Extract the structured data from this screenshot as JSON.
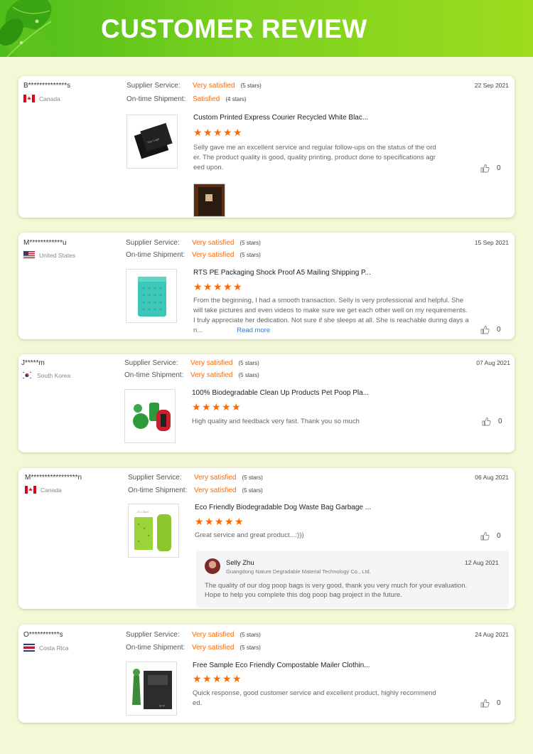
{
  "banner": {
    "title": "CUSTOMER REVIEW"
  },
  "colors": {
    "accent": "#ff6a00",
    "banner_green": "#6cc81e",
    "link": "#3a78c9"
  },
  "labels": {
    "supplier_service": "Supplier Service:",
    "ontime_shipment": "On-time Shipment:"
  },
  "reviews": [
    {
      "user": "B**************s",
      "country": "Canada",
      "flag": "canada",
      "supplier_rating": "Very satisfied",
      "supplier_stars": "(5 stars)",
      "shipment_rating": "Satisfied",
      "shipment_stars": "(4 stars)",
      "date": "22 Sep 2021",
      "product_title": "Custom Printed Express Courier Recycled White Blac...",
      "stars": 5,
      "text_lines": [
        "Selly gave me an excellent service and regular follow-ups on the status of the ord",
        "er. The product quality is good, quality printing, product done to specifications agr",
        "eed upon."
      ],
      "likes": "0"
    },
    {
      "user": "M************u",
      "country": "United States",
      "flag": "usa",
      "supplier_rating": "Very satisfied",
      "supplier_stars": "(5 stars)",
      "shipment_rating": "Very satisfied",
      "shipment_stars": "(5 stars)",
      "date": "15 Sep 2021",
      "product_title": "RTS PE Packaging Shock Proof A5 Mailing Shipping P...",
      "stars": 5,
      "text_lines": [
        "From the beginning, I had a smooth transaction. Selly is very professional and helpful. She",
        "will take pictures and even videos to make sure we get each other well on my requirements.",
        "I truly appreciate her dedication. Not sure if she sleeps at all. She is reachable during days a",
        "n..."
      ],
      "read_more": "Read more",
      "likes": "0"
    },
    {
      "user": "J*****m",
      "country": "South Korea",
      "flag": "korea",
      "supplier_rating": "Very satisfied",
      "supplier_stars": "(5 stars)",
      "shipment_rating": "Very satisfied",
      "shipment_stars": "(5 stars)",
      "date": "07 Aug 2021",
      "product_title": "100% Biodegradable Clean Up Products Pet Poop Pla...",
      "stars": 5,
      "text_lines": [
        "High quality and feedback very fast. Thank you so much"
      ],
      "likes": "0"
    },
    {
      "user": "M*****************n",
      "country": "Canada",
      "flag": "canada",
      "supplier_rating": "Very satisfied",
      "supplier_stars": "(5 stars)",
      "shipment_rating": "Very satisfied",
      "shipment_stars": "(5 stars)",
      "date": "06 Aug 2021",
      "product_title": "Eco Friendly Biodegradable Dog Waste Bag Garbage ...",
      "stars": 5,
      "text_lines": [
        "Great service and great product...:)))"
      ],
      "likes": "0",
      "reply": {
        "name": "Selly Zhu",
        "company": "Guangdong Nature Degradable Material Technology Co., Ltd.",
        "date": "12 Aug 2021",
        "text_lines": [
          "The quality of our dog poop bags is very good, thank you very much for your evaluation.",
          "Hope to help you complete this dog poop bag project in the future."
        ]
      }
    },
    {
      "user": "O***********s",
      "country": "Costa Rica",
      "flag": "costarica",
      "supplier_rating": "Very satisfied",
      "supplier_stars": "(5 stars)",
      "shipment_rating": "Very satisfied",
      "shipment_stars": "(5 stars)",
      "date": "24 Aug 2021",
      "product_title": "Free Sample Eco Friendly Compostable Mailer Clothin...",
      "stars": 5,
      "text_lines": [
        "Quick response, good customer service and excellent product, highly recommend",
        "ed."
      ],
      "likes": "0"
    }
  ]
}
